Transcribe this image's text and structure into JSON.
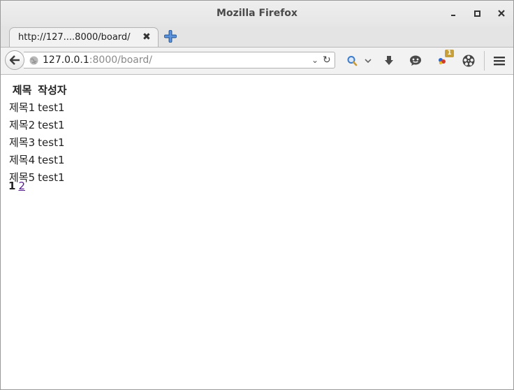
{
  "window": {
    "title": "Mozilla Firefox"
  },
  "tab": {
    "label": "http://127....8000/board/",
    "close_glyph": "✖"
  },
  "urlbar": {
    "host": "127.0.0.1",
    "rest": ":8000/board/",
    "dropdown_glyph": "⌄",
    "reload_glyph": "↻"
  },
  "toolbar": {
    "badge_count": "1"
  },
  "board": {
    "headers": [
      "제목",
      "작성자"
    ],
    "rows": [
      [
        "제목1",
        "test1"
      ],
      [
        "제목2",
        "test1"
      ],
      [
        "제목3",
        "test1"
      ],
      [
        "제목4",
        "test1"
      ],
      [
        "제목5",
        "test1"
      ]
    ]
  },
  "pager": {
    "current": "1",
    "pages": [
      "2"
    ]
  },
  "colors": {
    "visited_link": "#551a8b",
    "badge": "#c7a03c",
    "newtab_plus": "#3b73c9"
  },
  "icons": [
    "minimize-icon",
    "maximize-icon",
    "close-icon",
    "tab-close-icon",
    "new-tab-icon",
    "back-arrow-icon",
    "globe-icon",
    "search-icon",
    "download-icon",
    "chat-icon",
    "addon-icon",
    "film-reel-icon",
    "hamburger-menu-icon"
  ]
}
